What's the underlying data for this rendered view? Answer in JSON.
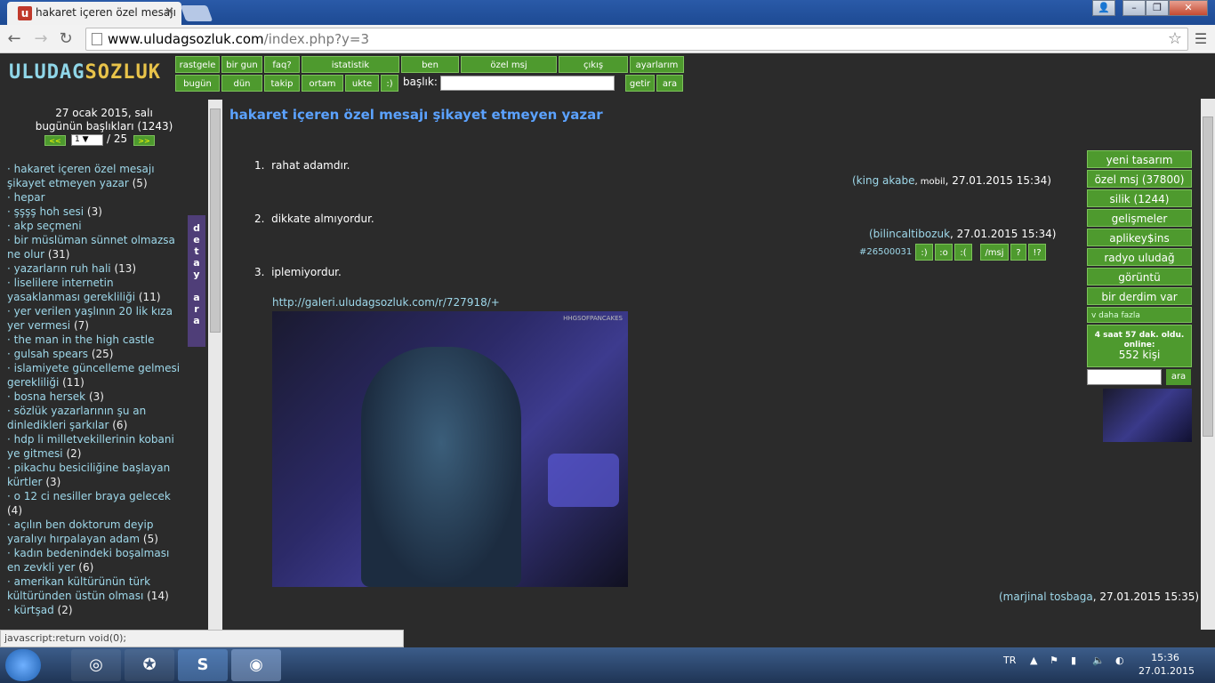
{
  "browser": {
    "tab_title": "hakaret içeren özel mesajı",
    "url_host": "www.uludagsozluk.com",
    "url_path": "/index.php?y=3",
    "status_text": "javascript:return void(0);"
  },
  "site": {
    "logo_part1": "ULUDAG",
    "logo_part2": "SOZLUK",
    "nav_row1": [
      "rastgele",
      "bir gun",
      "faq?",
      "istatistik",
      "ben",
      "özel msj",
      "çıkış",
      "ayarlarım"
    ],
    "nav_row2": [
      "bugün",
      "dün",
      "takip",
      "ortam",
      "ukte",
      ":)"
    ],
    "search_label": "başlık:",
    "go_label": "getir",
    "search_btn": "ara"
  },
  "left": {
    "date": "27 ocak 2015, salı",
    "today_titles": "bugünün başlıkları (1243)",
    "prev": "<<",
    "next": ">>",
    "page": "1",
    "total": "/ 25",
    "side_tab": "d e t a y   a r a",
    "titles": [
      {
        "t": "hakaret içeren özel mesajı şikayet etmeyen yazar",
        "c": "(5)"
      },
      {
        "t": "hepar",
        "c": ""
      },
      {
        "t": "şşşş hoh sesi",
        "c": "(3)"
      },
      {
        "t": "akp seçmeni",
        "c": ""
      },
      {
        "t": "bir müslüman sünnet olmazsa ne olur",
        "c": "(31)"
      },
      {
        "t": "yazarların ruh hali",
        "c": "(13)"
      },
      {
        "t": "liselilere internetin yasaklanması gerekliliği",
        "c": "(11)"
      },
      {
        "t": "yer verilen yaşlının 20 lik kıza yer vermesi",
        "c": "(7)"
      },
      {
        "t": "the man in the high castle",
        "c": ""
      },
      {
        "t": "gulsah spears",
        "c": "(25)"
      },
      {
        "t": "islamiyete güncelleme gelmesi gerekliliği",
        "c": "(11)"
      },
      {
        "t": "bosna hersek",
        "c": "(3)"
      },
      {
        "t": "sözlük yazarlarının şu an dinledikleri şarkılar",
        "c": "(6)"
      },
      {
        "t": "hdp li milletvekillerinin kobani ye gitmesi",
        "c": "(2)"
      },
      {
        "t": "pikachu besiciliğine başlayan kürtler",
        "c": "(3)"
      },
      {
        "t": "o 12 ci nesiller braya gelecek",
        "c": "(4)"
      },
      {
        "t": "açılın ben doktorum deyip yaralıyı hırpalayan adam",
        "c": "(5)"
      },
      {
        "t": "kadın bedenindeki boşalması en zevkli yer",
        "c": "(6)"
      },
      {
        "t": "amerikan kültürünün türk kültüründen üstün olması",
        "c": "(14)"
      },
      {
        "t": "kürtşad",
        "c": "(2)"
      }
    ]
  },
  "main": {
    "title": "hakaret içeren özel mesajı şikayet etmeyen yazar",
    "entries": [
      {
        "num": "1.",
        "text": "rahat adamdır.",
        "author": "(king akabe",
        "mobile": ", mobil",
        "date": ", 27.01.2015 15:34)"
      },
      {
        "num": "2.",
        "text": "dikkate almıyordur.",
        "author": "(bilincaltibozuk",
        "date": ", 27.01.2015 15:34)"
      },
      {
        "num": "3.",
        "text": "iplemiyordur.",
        "author": "(marjinal tosbaga",
        "date": ", 27.01.2015 15:35)"
      }
    ],
    "entry_id": "#26500031",
    "actions": [
      ":)",
      ":o",
      ":(",
      "/msj",
      "?",
      "!?"
    ],
    "link": "http://galeri.uludagsozluk.com/r/727918/+",
    "gif_watermark": "HHGSOFPANCAKES"
  },
  "right": {
    "buttons": [
      "yeni tasarım",
      "özel msj (37800)",
      "silik (1244)",
      "gelişmeler",
      "aplikey$ins",
      "radyo uludağ",
      "görüntü",
      "bir derdim var"
    ],
    "more": "v daha fazla",
    "online_time": "4 saat 57 dak. oldu.",
    "online_label": "online:",
    "online_count": "552 kişi",
    "search_btn": "ara"
  },
  "taskbar": {
    "lang": "TR",
    "time": "15:36",
    "date": "27.01.2015"
  }
}
